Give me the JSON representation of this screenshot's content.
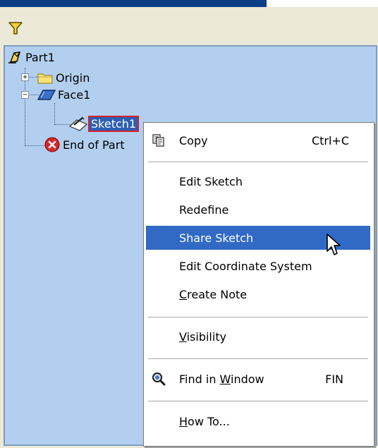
{
  "toolbar": {
    "filter_icon": "filter-icon"
  },
  "tree": {
    "root": "Part1",
    "origin": "Origin",
    "face": "Face1",
    "sketch": "Sketch1",
    "end": "End of Part",
    "end_visible": "End of Part"
  },
  "menu": {
    "copy": "Copy",
    "copy_shortcut": "Ctrl+C",
    "edit_sketch": "Edit Sketch",
    "redefine": "Redefine",
    "share_sketch": "Share Sketch",
    "edit_coord": "Edit Coordinate System",
    "create_note": "Create Note",
    "visibility": "Visibility",
    "find_in_window": "Find in Window",
    "find_shortcut": "FIN",
    "how_to": "How To..."
  },
  "colors": {
    "selection": "#316ac5",
    "tree_bg": "#b2cfef",
    "accent_red": "#d81e2b"
  }
}
